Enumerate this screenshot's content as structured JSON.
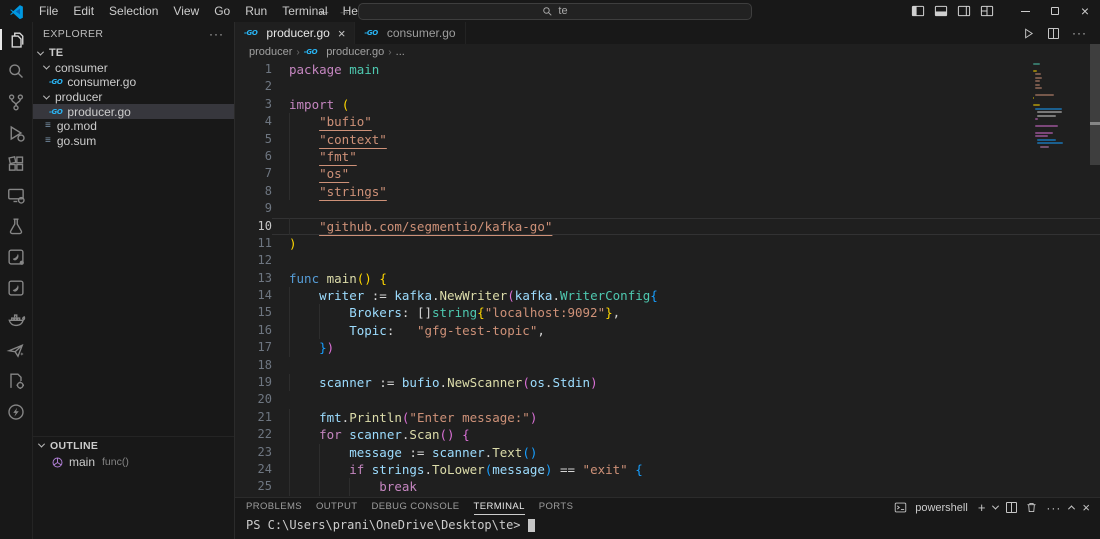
{
  "titlebar": {
    "menus": [
      "File",
      "Edit",
      "Selection",
      "View",
      "Go",
      "Run",
      "Terminal",
      "Help"
    ],
    "back_arrow": "←",
    "forward_arrow": "→",
    "search_value": "te",
    "window_icons": [
      "toggle-primary-sidebar-icon",
      "toggle-panel-icon",
      "toggle-secondary-sidebar-icon",
      "customize-layout-icon"
    ],
    "window_controls": [
      "minimize-button",
      "maximize-button",
      "close-button"
    ]
  },
  "activity_bar": {
    "items": [
      {
        "name": "explorer-icon",
        "active": true
      },
      {
        "name": "search-icon",
        "active": false
      },
      {
        "name": "source-control-icon",
        "active": false
      },
      {
        "name": "run-debug-icon",
        "active": false
      },
      {
        "name": "extensions-icon",
        "active": false
      },
      {
        "name": "remote-explorer-icon",
        "active": false
      },
      {
        "name": "testing-icon",
        "active": false
      },
      {
        "name": "bird-extension-icon",
        "active": false
      },
      {
        "name": "bird-alt-extension-icon",
        "active": false
      },
      {
        "name": "docker-icon",
        "active": false
      },
      {
        "name": "paper-plane-extension-icon",
        "active": false
      },
      {
        "name": "settings-file-extension-icon",
        "active": false
      },
      {
        "name": "thunder-client-icon",
        "active": false
      }
    ]
  },
  "explorer": {
    "title": "EXPLORER",
    "more_actions": "···",
    "root": "TE",
    "items": [
      {
        "label": "consumer",
        "type": "folder",
        "expanded": true
      },
      {
        "label": "consumer.go",
        "type": "go-file",
        "nested": true
      },
      {
        "label": "producer",
        "type": "folder",
        "expanded": true
      },
      {
        "label": "producer.go",
        "type": "go-file",
        "nested": true,
        "selected": true
      },
      {
        "label": "go.mod",
        "type": "file",
        "nested": false
      },
      {
        "label": "go.sum",
        "type": "file",
        "nested": false
      }
    ],
    "outline": {
      "title": "OUTLINE",
      "symbol": "main",
      "detail": "func()"
    }
  },
  "editor": {
    "tabs": [
      {
        "label": "producer.go",
        "active": true
      },
      {
        "label": "consumer.go",
        "active": false
      }
    ],
    "breadcrumb": [
      "producer",
      "producer.go",
      "..."
    ],
    "token_colors": {
      "kw": "#C586C0",
      "fk": "#569CD6",
      "fn": "#DCDCAA",
      "v": "#9CDCFE",
      "ty": "#4EC9B0",
      "s": "#CE9178",
      "su": "#CE9178",
      "b1": "#FFD700",
      "b2": "#DA70D6",
      "b3": "#179FFF",
      "op": "#D4D4D4",
      "tx": "#D4D4D4"
    },
    "lines": [
      {
        "n": 1,
        "ind": 0,
        "t": [
          [
            "kw",
            "package"
          ],
          [
            "tx",
            " "
          ],
          [
            "ty",
            "main"
          ]
        ]
      },
      {
        "n": 2,
        "ind": 0,
        "t": []
      },
      {
        "n": 3,
        "ind": 0,
        "t": [
          [
            "kw",
            "import"
          ],
          [
            "tx",
            " "
          ],
          [
            "b1",
            "("
          ]
        ]
      },
      {
        "n": 4,
        "ind": 1,
        "t": [
          [
            "su",
            "\"bufio\""
          ]
        ]
      },
      {
        "n": 5,
        "ind": 1,
        "t": [
          [
            "su",
            "\"context\""
          ]
        ]
      },
      {
        "n": 6,
        "ind": 1,
        "t": [
          [
            "su",
            "\"fmt\""
          ]
        ]
      },
      {
        "n": 7,
        "ind": 1,
        "t": [
          [
            "su",
            "\"os\""
          ]
        ]
      },
      {
        "n": 8,
        "ind": 1,
        "t": [
          [
            "su",
            "\"strings\""
          ]
        ]
      },
      {
        "n": 9,
        "ind": 0,
        "t": []
      },
      {
        "n": 10,
        "ind": 1,
        "cur": true,
        "t": [
          [
            "su",
            "\"github.com/segmentio/kafka-go\""
          ]
        ]
      },
      {
        "n": 11,
        "ind": 0,
        "t": [
          [
            "b1",
            ")"
          ]
        ]
      },
      {
        "n": 12,
        "ind": 0,
        "t": []
      },
      {
        "n": 13,
        "ind": 0,
        "t": [
          [
            "fk",
            "func"
          ],
          [
            "tx",
            " "
          ],
          [
            "fn",
            "main"
          ],
          [
            "b1",
            "()"
          ],
          [
            "tx",
            " "
          ],
          [
            "b1",
            "{"
          ]
        ]
      },
      {
        "n": 14,
        "ind": 1,
        "t": [
          [
            "v",
            "writer"
          ],
          [
            "op",
            " := "
          ],
          [
            "v",
            "kafka"
          ],
          [
            "tx",
            "."
          ],
          [
            "fn",
            "NewWriter"
          ],
          [
            "b2",
            "("
          ],
          [
            "v",
            "kafka"
          ],
          [
            "tx",
            "."
          ],
          [
            "ty",
            "WriterConfig"
          ],
          [
            "b3",
            "{"
          ]
        ]
      },
      {
        "n": 15,
        "ind": 2,
        "t": [
          [
            "v",
            "Brokers"
          ],
          [
            "tx",
            ": "
          ],
          [
            "op",
            "[]"
          ],
          [
            "ty",
            "string"
          ],
          [
            "b1",
            "{"
          ],
          [
            "s",
            "\"localhost:9092\""
          ],
          [
            "b1",
            "}"
          ],
          [
            "tx",
            ","
          ]
        ]
      },
      {
        "n": 16,
        "ind": 2,
        "t": [
          [
            "v",
            "Topic"
          ],
          [
            "tx",
            ":   "
          ],
          [
            "s",
            "\"gfg-test-topic\""
          ],
          [
            "tx",
            ","
          ]
        ]
      },
      {
        "n": 17,
        "ind": 1,
        "t": [
          [
            "b3",
            "}"
          ],
          [
            "b2",
            ")"
          ]
        ]
      },
      {
        "n": 18,
        "ind": 0,
        "t": []
      },
      {
        "n": 19,
        "ind": 1,
        "t": [
          [
            "v",
            "scanner"
          ],
          [
            "op",
            " := "
          ],
          [
            "v",
            "bufio"
          ],
          [
            "tx",
            "."
          ],
          [
            "fn",
            "NewScanner"
          ],
          [
            "b2",
            "("
          ],
          [
            "v",
            "os"
          ],
          [
            "tx",
            "."
          ],
          [
            "v",
            "Stdin"
          ],
          [
            "b2",
            ")"
          ]
        ]
      },
      {
        "n": 20,
        "ind": 0,
        "t": []
      },
      {
        "n": 21,
        "ind": 1,
        "t": [
          [
            "v",
            "fmt"
          ],
          [
            "tx",
            "."
          ],
          [
            "fn",
            "Println"
          ],
          [
            "b2",
            "("
          ],
          [
            "s",
            "\"Enter message:\""
          ],
          [
            "b2",
            ")"
          ]
        ]
      },
      {
        "n": 22,
        "ind": 1,
        "t": [
          [
            "kw",
            "for"
          ],
          [
            "tx",
            " "
          ],
          [
            "v",
            "scanner"
          ],
          [
            "tx",
            "."
          ],
          [
            "fn",
            "Scan"
          ],
          [
            "b2",
            "()"
          ],
          [
            "tx",
            " "
          ],
          [
            "b2",
            "{"
          ]
        ]
      },
      {
        "n": 23,
        "ind": 2,
        "t": [
          [
            "v",
            "message"
          ],
          [
            "op",
            " := "
          ],
          [
            "v",
            "scanner"
          ],
          [
            "tx",
            "."
          ],
          [
            "fn",
            "Text"
          ],
          [
            "b3",
            "()"
          ]
        ]
      },
      {
        "n": 24,
        "ind": 2,
        "t": [
          [
            "kw",
            "if"
          ],
          [
            "tx",
            " "
          ],
          [
            "v",
            "strings"
          ],
          [
            "tx",
            "."
          ],
          [
            "fn",
            "ToLower"
          ],
          [
            "b3",
            "("
          ],
          [
            "v",
            "message"
          ],
          [
            "b3",
            ")"
          ],
          [
            "op",
            " == "
          ],
          [
            "s",
            "\"exit\""
          ],
          [
            "tx",
            " "
          ],
          [
            "b3",
            "{"
          ]
        ]
      },
      {
        "n": 25,
        "ind": 3,
        "t": [
          [
            "kw",
            "break"
          ]
        ]
      }
    ]
  },
  "panel": {
    "tabs": [
      "PROBLEMS",
      "OUTPUT",
      "DEBUG CONSOLE",
      "TERMINAL",
      "PORTS"
    ],
    "active_tab": "TERMINAL",
    "shell_label": "powershell",
    "prompt": "PS C:\\Users\\prani\\OneDrive\\Desktop\\te>"
  },
  "colors": {
    "editor_bg": "#1F1F1F",
    "chrome_bg": "#181818",
    "selection_bg": "#37373D",
    "go_icon_cyan": "#29B6F6",
    "outline_method_purple": "#B180D7",
    "accent_blue": "#0078D4"
  }
}
